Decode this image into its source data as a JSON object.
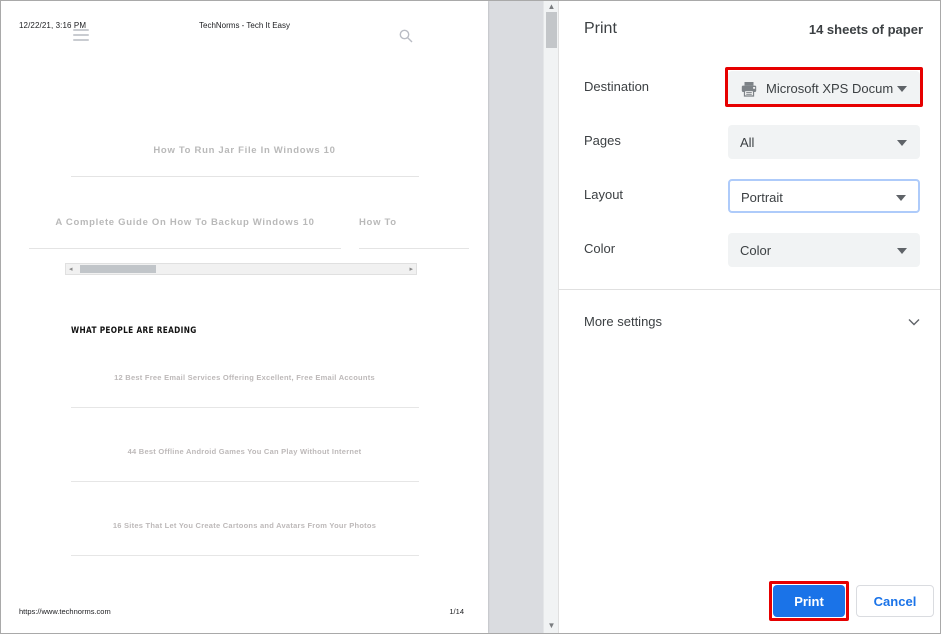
{
  "preview": {
    "header": {
      "timestamp": "12/22/21, 3:16 PM",
      "site_title": "TechNorms - Tech It Easy"
    },
    "articles_row_one": [
      {
        "title": "How To Run Jar File In Windows 10"
      }
    ],
    "articles_row_two": [
      {
        "title": "A Complete Guide On How To Backup Windows 10"
      },
      {
        "title": "How To"
      }
    ],
    "section_heading": "WHAT PEOPLE ARE READING",
    "reading_list": [
      {
        "title": "12 Best Free Email Services Offering Excellent, Free Email Accounts"
      },
      {
        "title": "44 Best Offline Android Games You Can Play Without Internet"
      },
      {
        "title": "16 Sites That Let You Create Cartoons and Avatars From Your Photos"
      }
    ],
    "footer": {
      "url": "https://www.technorms.com",
      "page_number": "1/14"
    },
    "icons": {
      "menu": "hamburger-icon",
      "search": "search-icon"
    },
    "scrollbars": {
      "horizontal_left_arrow": "◂",
      "horizontal_right_arrow": "▸",
      "vertical_up_arrow": "▲",
      "vertical_down_arrow": "▼"
    }
  },
  "print_dialog": {
    "title": "Print",
    "sheets_summary": "14 sheets of paper",
    "settings": [
      {
        "label": "Destination",
        "value": "Microsoft XPS Docum",
        "icon": "printer-icon",
        "focused": false,
        "highlighted": true
      },
      {
        "label": "Pages",
        "value": "All",
        "icon": null,
        "focused": false,
        "highlighted": false
      },
      {
        "label": "Layout",
        "value": "Portrait",
        "icon": null,
        "focused": true,
        "highlighted": false
      },
      {
        "label": "Color",
        "value": "Color",
        "icon": null,
        "focused": false,
        "highlighted": false
      }
    ],
    "more_settings": {
      "label": "More settings",
      "chevron": "chevron-down-icon"
    },
    "actions": {
      "print_label": "Print",
      "cancel_label": "Cancel"
    },
    "colors": {
      "accent": "#1a73e8",
      "highlight": "#e60000",
      "field_background": "#f1f3f4",
      "focus_ring": "#aecbfa",
      "text": "#3c4043"
    }
  }
}
